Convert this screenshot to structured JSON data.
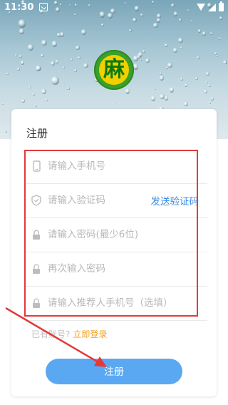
{
  "status_bar": {
    "time": "11:30"
  },
  "logo": {
    "text": "麻"
  },
  "register_card": {
    "title": "注册",
    "phone_placeholder": "请输入手机号",
    "code_placeholder": "请输入验证码",
    "send_code_label": "发送验证码",
    "password_placeholder": "请输入密码(最少6位)",
    "confirm_password_placeholder": "再次输入密码",
    "referrer_placeholder": "请输入推荐人手机号（选填）",
    "have_account_text": "已有账号?",
    "login_link": "立即登录",
    "register_button": "注册"
  },
  "colors": {
    "accent_blue": "#5aa8f2",
    "link_orange": "#f0a01e",
    "annotation_red": "#e23a3a",
    "logo_green": "#3aa02a",
    "logo_yellow": "#f2d000"
  },
  "icons": [
    "notification-icon",
    "wifi-icon",
    "signal-icon",
    "battery-icon",
    "phone-icon",
    "shield-icon",
    "lock-icon"
  ]
}
